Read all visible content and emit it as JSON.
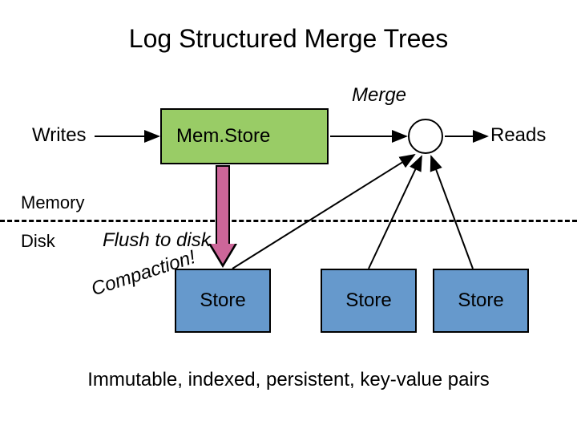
{
  "title": "Log Structured Merge Trees",
  "labels": {
    "merge": "Merge",
    "writes": "Writes",
    "reads": "Reads",
    "memory": "Memory",
    "disk": "Disk",
    "flush": "Flush to disk",
    "compaction": "Compaction!"
  },
  "boxes": {
    "memstore": "Mem.Store",
    "store1": "Store",
    "store2": "Store",
    "store3": "Store"
  },
  "footer": "Immutable, indexed, persistent, key-value pairs"
}
